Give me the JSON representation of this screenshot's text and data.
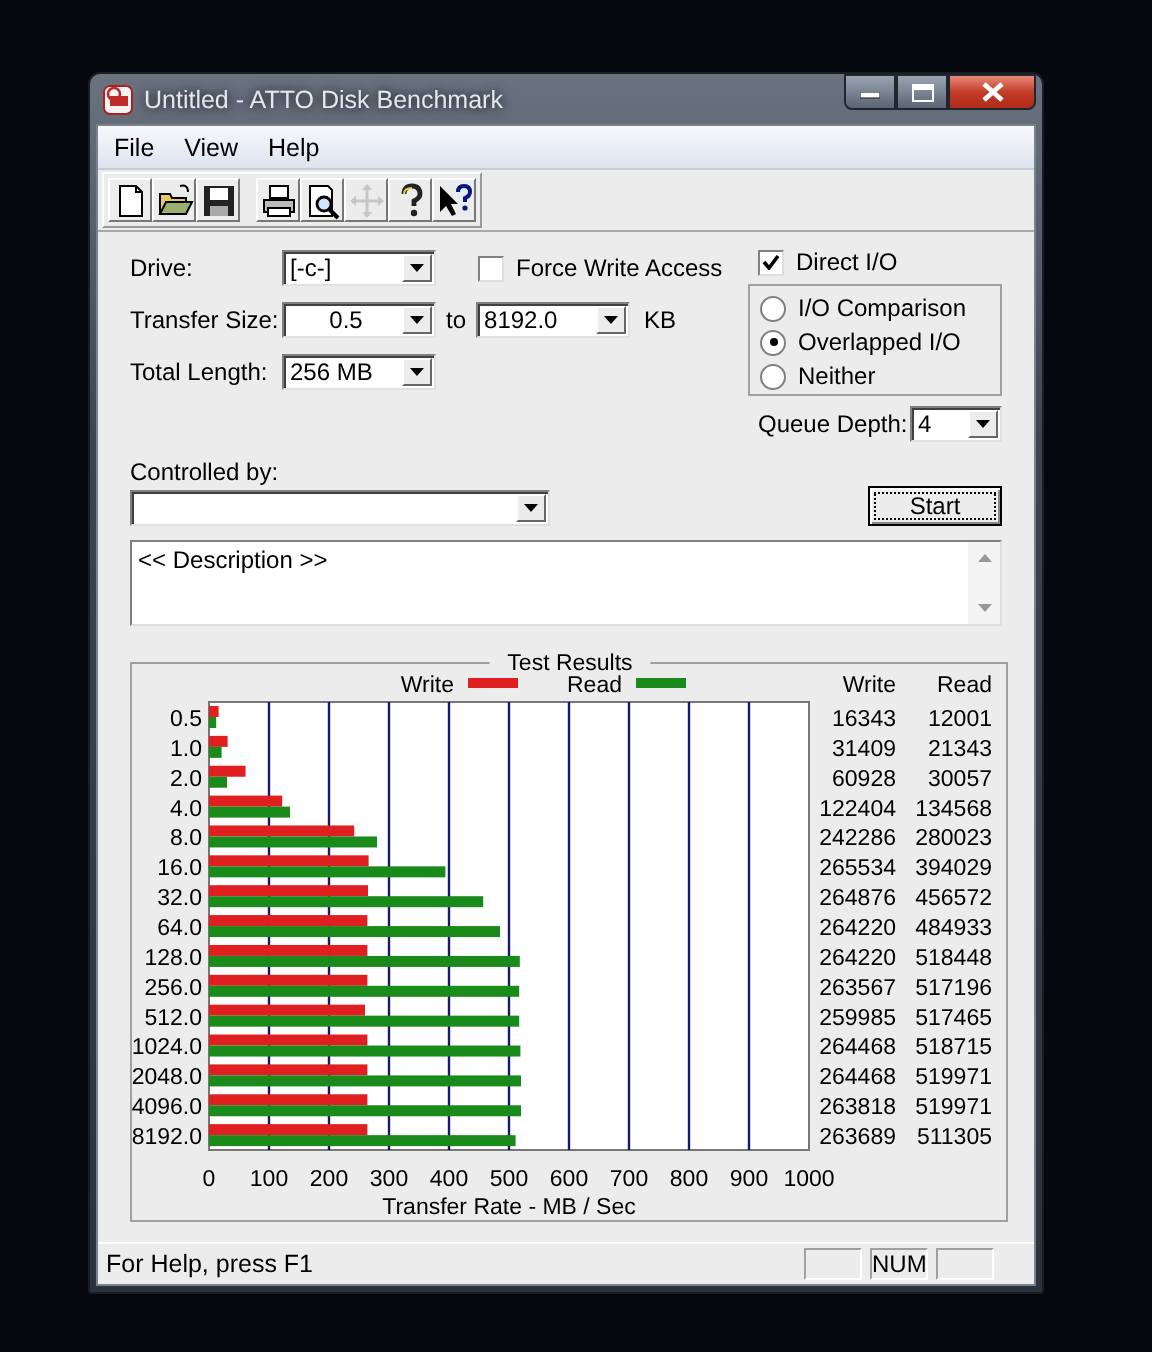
{
  "window": {
    "title": "Untitled - ATTO Disk Benchmark"
  },
  "menu": [
    "File",
    "View",
    "Help"
  ],
  "toolbar": [
    {
      "kind": "new",
      "disabled": false
    },
    {
      "kind": "open",
      "disabled": false
    },
    {
      "kind": "save",
      "disabled": false
    },
    {
      "kind": "print",
      "disabled": false
    },
    {
      "kind": "preview",
      "disabled": false
    },
    {
      "kind": "move",
      "disabled": true
    },
    {
      "kind": "help",
      "disabled": false
    },
    {
      "kind": "context_help",
      "disabled": false
    }
  ],
  "form": {
    "drive": {
      "label": "Drive:",
      "value": "[-c-]"
    },
    "force_write_access": {
      "label": "Force Write Access",
      "checked": false
    },
    "transfer_size": {
      "label": "Transfer Size:",
      "from": "0.5",
      "to_label": "to",
      "to": "8192.0",
      "unit": "KB"
    },
    "total_length": {
      "label": "Total Length:",
      "value": "256 MB"
    },
    "direct_io": {
      "label": "Direct I/O",
      "checked": true
    },
    "io_modes": [
      {
        "label": "I/O Comparison",
        "selected": false
      },
      {
        "label": "Overlapped I/O",
        "selected": true
      },
      {
        "label": "Neither",
        "selected": false
      }
    ],
    "queue_depth": {
      "label": "Queue Depth:",
      "value": "4"
    },
    "controlled_by": {
      "label": "Controlled by:"
    },
    "start_button": "Start",
    "description": "<< Description >>"
  },
  "results": {
    "title": "Test Results",
    "columns": [
      "Write",
      "Read"
    ],
    "rows": [
      {
        "write": "16343",
        "read": "12001"
      },
      {
        "write": "31409",
        "read": "21343"
      },
      {
        "write": "60928",
        "read": "30057"
      },
      {
        "write": "122404",
        "read": "134568"
      },
      {
        "write": "242286",
        "read": "280023"
      },
      {
        "write": "265534",
        "read": "394029"
      },
      {
        "write": "264876",
        "read": "456572"
      },
      {
        "write": "264220",
        "read": "484933"
      },
      {
        "write": "264220",
        "read": "518448"
      },
      {
        "write": "263567",
        "read": "517196"
      },
      {
        "write": "259985",
        "read": "517465"
      },
      {
        "write": "264468",
        "read": "518715"
      },
      {
        "write": "264468",
        "read": "519971"
      },
      {
        "write": "263818",
        "read": "519971"
      },
      {
        "write": "263689",
        "read": "511305"
      }
    ],
    "chart_data": {
      "type": "bar",
      "orientation": "horizontal",
      "xlabel": "Transfer Rate - MB / Sec",
      "categories": [
        "0.5",
        "1.0",
        "2.0",
        "4.0",
        "8.0",
        "16.0",
        "32.0",
        "64.0",
        "128.0",
        "256.0",
        "512.0",
        "1024.0",
        "2048.0",
        "4096.0",
        "8192.0"
      ],
      "series": [
        {
          "name": "Write",
          "color": "#e02020",
          "values": [
            16,
            31,
            61,
            122,
            242,
            266,
            265,
            264,
            264,
            264,
            260,
            264,
            264,
            264,
            264
          ]
        },
        {
          "name": "Read",
          "color": "#1a8a1a",
          "values": [
            12,
            21,
            30,
            135,
            280,
            394,
            457,
            485,
            518,
            517,
            517,
            519,
            520,
            520,
            511
          ]
        }
      ],
      "grid": true,
      "legend": true,
      "xlim": [
        0,
        1000
      ],
      "xticks": [
        0,
        100,
        200,
        300,
        400,
        500,
        600,
        700,
        800,
        900,
        1000
      ]
    }
  },
  "status_bar": {
    "text": "For Help, press F1",
    "indicator": "NUM"
  }
}
